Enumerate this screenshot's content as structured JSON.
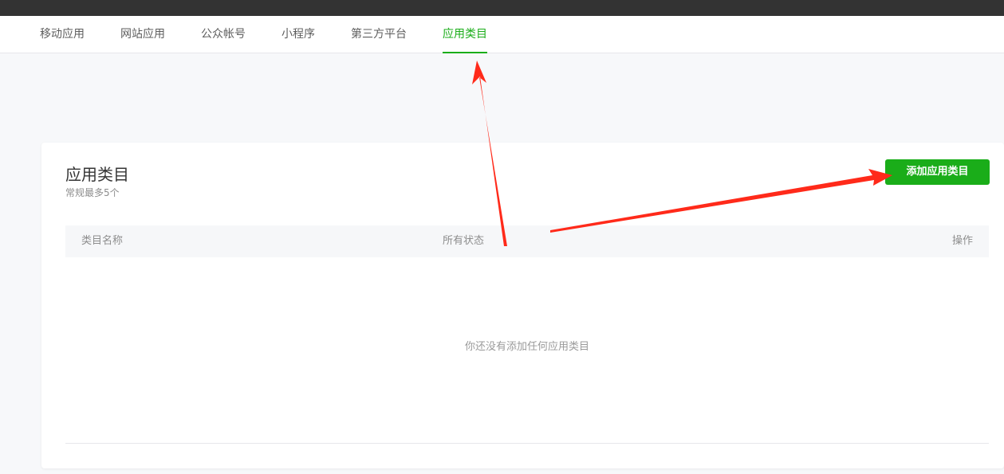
{
  "tabs": [
    {
      "label": "移动应用"
    },
    {
      "label": "网站应用"
    },
    {
      "label": "公众帐号"
    },
    {
      "label": "小程序"
    },
    {
      "label": "第三方平台"
    },
    {
      "label": "应用类目",
      "active": true
    }
  ],
  "card": {
    "title": "应用类目",
    "subtitle": "常规最多5个",
    "add_button_label": "添加应用类目",
    "table": {
      "columns": [
        "类目名称",
        "所有状态",
        "操作"
      ],
      "rows": [],
      "empty_text": "你还没有添加任何应用类目"
    }
  },
  "colors": {
    "accent": "#1aad19",
    "topbar": "#333333",
    "page_bg": "#f7f8fa",
    "annotation_arrow": "#ff2a1a"
  }
}
